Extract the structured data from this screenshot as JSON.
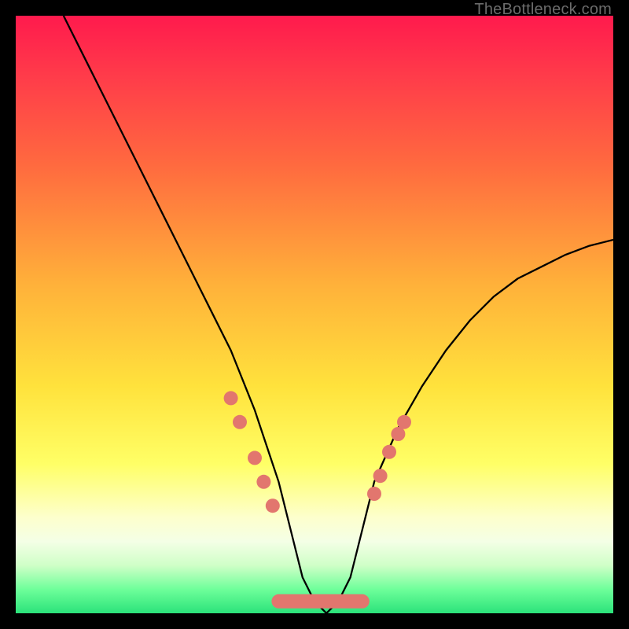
{
  "watermark": "TheBottleneck.com",
  "chart_data": {
    "type": "line",
    "title": "",
    "xlabel": "",
    "ylabel": "",
    "xlim": [
      0,
      100
    ],
    "ylim": [
      0,
      100
    ],
    "grid": false,
    "legend": false,
    "series": [
      {
        "name": "bottleneck-curve",
        "color": "#000000",
        "x": [
          8,
          12,
          16,
          20,
          24,
          28,
          32,
          36,
          40,
          42,
          44,
          46,
          48,
          50,
          52,
          54,
          56,
          58,
          60,
          64,
          68,
          72,
          76,
          80,
          84,
          88,
          92,
          96,
          100
        ],
        "y": [
          100,
          92,
          84,
          76,
          68,
          60,
          52,
          44,
          34,
          28,
          22,
          14,
          6,
          2,
          0,
          2,
          6,
          14,
          22,
          31,
          38,
          44,
          49,
          53,
          56,
          58,
          60,
          61.5,
          62.5
        ]
      }
    ],
    "markers": [
      {
        "name": "left-dot-1",
        "x": 36,
        "y": 36
      },
      {
        "name": "left-dot-2",
        "x": 37.5,
        "y": 32
      },
      {
        "name": "left-dot-3",
        "x": 40,
        "y": 26
      },
      {
        "name": "left-dot-4",
        "x": 41.5,
        "y": 22
      },
      {
        "name": "left-dot-5",
        "x": 43,
        "y": 18
      },
      {
        "name": "right-dot-1",
        "x": 60,
        "y": 20
      },
      {
        "name": "right-dot-2",
        "x": 61,
        "y": 23
      },
      {
        "name": "right-dot-3",
        "x": 62.5,
        "y": 27
      },
      {
        "name": "right-dot-4",
        "x": 64,
        "y": 30
      },
      {
        "name": "right-dot-5",
        "x": 65,
        "y": 32
      }
    ],
    "trough_band": {
      "name": "trough-marker-band",
      "x_start": 44,
      "x_end": 58,
      "y": 2,
      "color": "#e2766e"
    },
    "marker_color": "#e2766e",
    "marker_radius": 9
  }
}
